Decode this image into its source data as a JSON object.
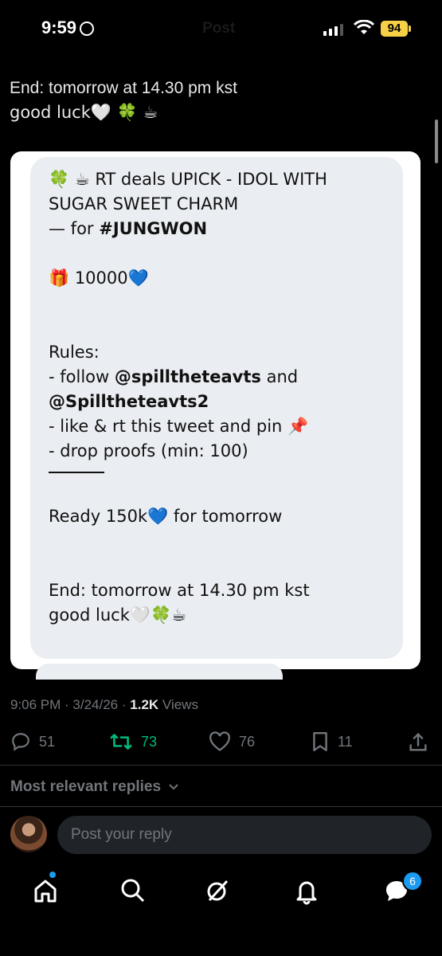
{
  "status_bar": {
    "time": "9:59",
    "battery": "94"
  },
  "header": {
    "title": "Post"
  },
  "tweet": {
    "text_line1": "End: tomorrow at 14.30 pm kst",
    "text_line2": "good luck🤍 🍀 ☕"
  },
  "embedded": {
    "line1": "🍀 ☕ RT deals  UPICK - IDOL WITH",
    "line2": "SUGAR SWEET CHARM",
    "line3_prefix": "— for ",
    "line3_tag": "#JUNGWON",
    "gift": "🎁 10000💙",
    "rules_title": "Rules:",
    "rule1_prefix": "- follow ",
    "rule1_handle1": "@spilltheteavts",
    "rule1_and": " and",
    "rule1_handle2": "@Spilltheteavts2",
    "rule2": "- like & rt this tweet and pin 📌",
    "rule3": "- drop proofs (min: 100)",
    "ready": "Ready 150k💙 for tomorrow",
    "end1": "End: tomorrow at 14.30 pm kst",
    "end2": "good luck🤍🍀☕"
  },
  "meta": {
    "time": "9:06 PM",
    "sep1": " · ",
    "date": "3/24/26",
    "sep2": " · ",
    "views_count": "1.2K",
    "views_label": " Views"
  },
  "actions": {
    "replies": "51",
    "reposts": "73",
    "likes": "76",
    "bookmarks": "11"
  },
  "replies_sort": {
    "label": "Most relevant replies"
  },
  "reply_box": {
    "placeholder": "Post your reply"
  },
  "tab_bar": {
    "messages_badge": "6"
  },
  "colors": {
    "accent": "#1d9bf0",
    "repost": "#00ba7c",
    "muted": "#71767b",
    "battery": "#f7d046"
  }
}
